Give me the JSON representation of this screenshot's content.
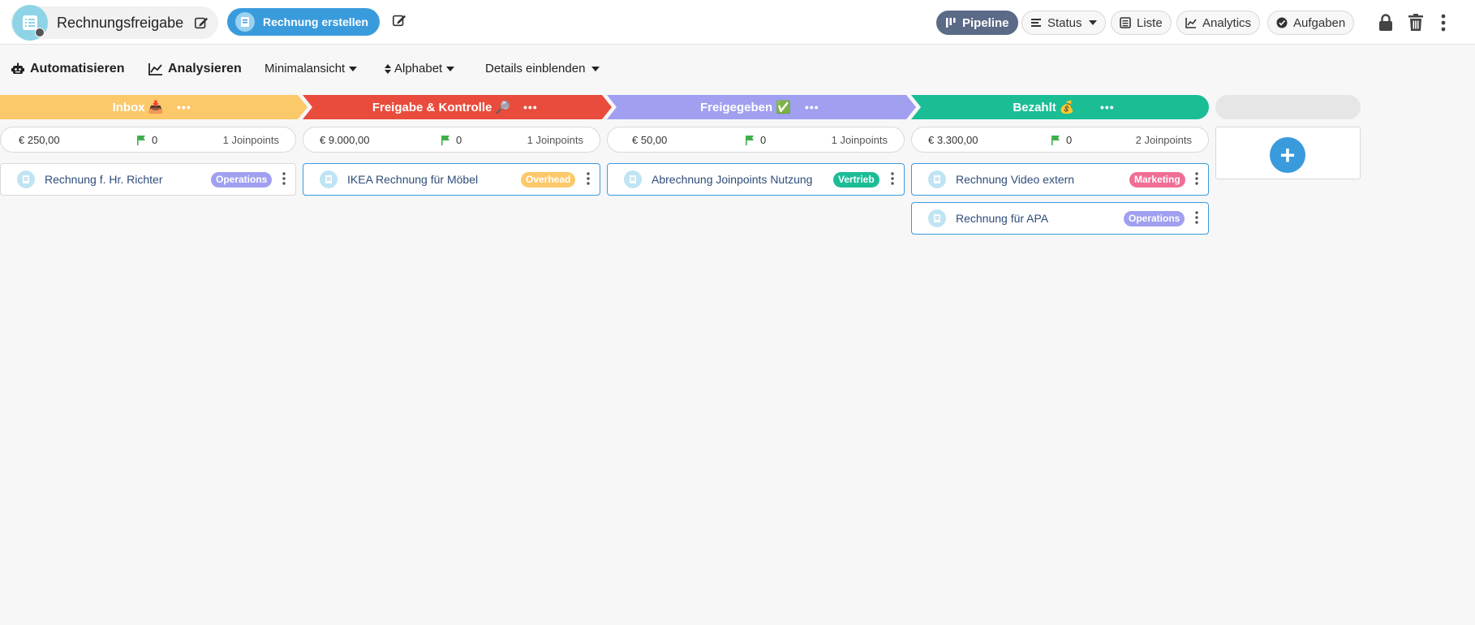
{
  "app": {
    "title": "Rechnungsfreigabe",
    "create_label": "Rechnung erstellen"
  },
  "nav": {
    "pipeline": "Pipeline",
    "status": "Status",
    "liste": "Liste",
    "analytics": "Analytics",
    "aufgaben": "Aufgaben"
  },
  "toolbar": {
    "automatisieren": "Automatisieren",
    "analysieren": "Analysieren",
    "minimalansicht": "Minimalansicht",
    "alphabet": "Alphabet",
    "details": "Details einblenden"
  },
  "colors": {
    "inbox": "#fbc86a",
    "freigabe": "#e94b3c",
    "freigegeben": "#a09ff0",
    "bezahlt": "#1bbd95",
    "accent": "#3a9bdc"
  },
  "columns": [
    {
      "name": "Inbox 📥",
      "dots": "•••",
      "amount": "€ 250,00",
      "count": "0",
      "joinpoints": "1 Joinpoints",
      "cards": [
        {
          "title": "Rechnung f. Hr. Richter",
          "tag": "Operations"
        }
      ]
    },
    {
      "name": "Freigabe & Kontrolle 🔎",
      "dots": "•••",
      "amount": "€ 9.000,00",
      "count": "0",
      "joinpoints": "1 Joinpoints",
      "cards": [
        {
          "title": "IKEA Rechnung für Möbel",
          "tag": "Overhead"
        }
      ]
    },
    {
      "name": "Freigegeben ✅",
      "dots": "•••",
      "amount": "€ 50,00",
      "count": "0",
      "joinpoints": "1 Joinpoints",
      "cards": [
        {
          "title": "Abrechnung Joinpoints Nutzung",
          "tag": "Vertrieb"
        }
      ]
    },
    {
      "name": "Bezahlt 💰",
      "dots": "•••",
      "amount": "€ 3.300,00",
      "count": "0",
      "joinpoints": "2 Joinpoints",
      "cards": [
        {
          "title": "Rechnung Video extern",
          "tag": "Marketing"
        },
        {
          "title": "Rechnung für APA",
          "tag": "Operations"
        }
      ]
    }
  ],
  "add_column": {
    "label": "+"
  }
}
